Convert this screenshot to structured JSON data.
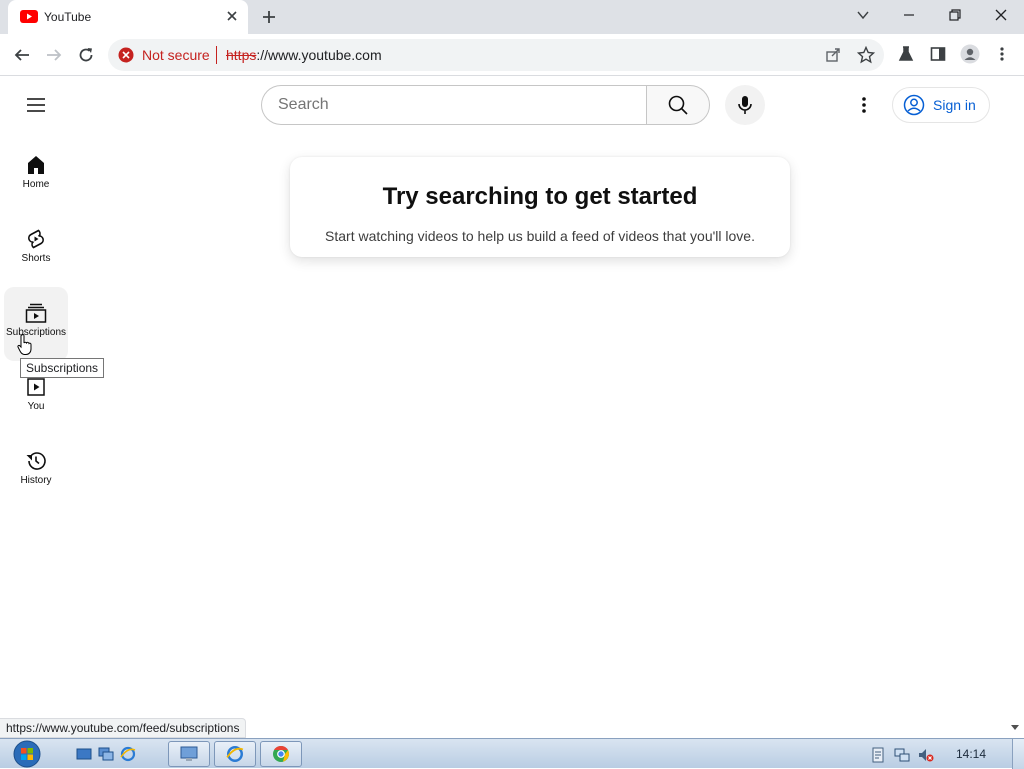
{
  "browser": {
    "tab_title": "YouTube",
    "omnibox": {
      "security_label": "Not secure",
      "url_scheme": "https",
      "url_rest": "://www.youtube.com"
    },
    "status_url": "https://www.youtube.com/feed/subscriptions"
  },
  "youtube": {
    "search_placeholder": "Search",
    "sign_in": "Sign in",
    "guide": [
      {
        "label": "Home",
        "icon": "home-icon"
      },
      {
        "label": "Shorts",
        "icon": "shorts-icon"
      },
      {
        "label": "Subscriptions",
        "icon": "subscriptions-icon"
      },
      {
        "label": "You",
        "icon": "you-icon"
      },
      {
        "label": "History",
        "icon": "history-icon"
      }
    ],
    "tooltip": "Subscriptions",
    "prompt_title": "Try searching to get started",
    "prompt_subtitle": "Start watching videos to help us build a feed of videos that you'll love."
  },
  "taskbar": {
    "clock": "14:14"
  },
  "colors": {
    "youtube_red": "#ff0000",
    "link_blue": "#065fd4",
    "insecure_red": "#c5221f"
  }
}
